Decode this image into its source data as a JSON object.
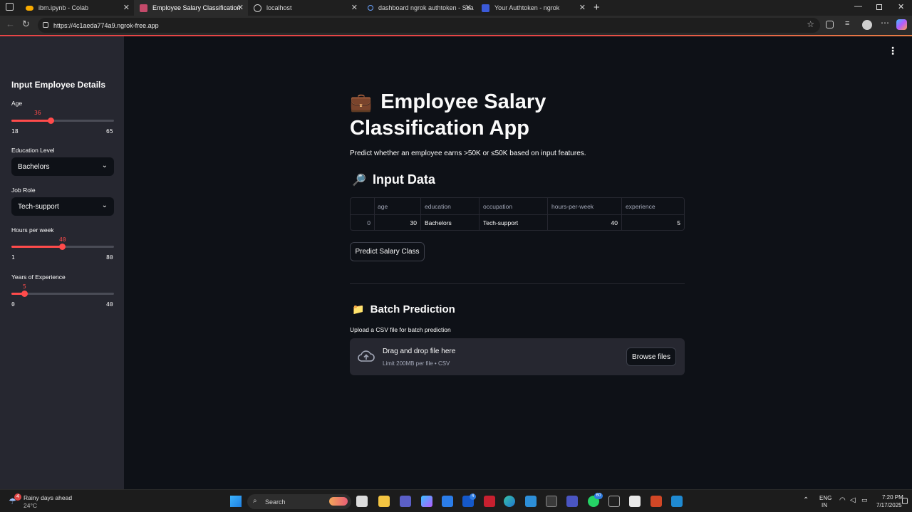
{
  "browser": {
    "tabs": [
      {
        "label": "ibm.ipynb - Colab",
        "active": false
      },
      {
        "label": "Employee Salary Classification",
        "active": true
      },
      {
        "label": "localhost",
        "active": false
      },
      {
        "label": "dashboard ngrok authtoken - Sea",
        "active": false
      },
      {
        "label": "Your Authtoken - ngrok",
        "active": false
      }
    ],
    "url": "https://4c1aeda774a9.ngrok-free.app"
  },
  "sidebar": {
    "title": "Input Employee Details",
    "age": {
      "label": "Age",
      "value": "36",
      "min": "18",
      "max": "65",
      "fraction": 0.383
    },
    "education": {
      "label": "Education Level",
      "selected": "Bachelors"
    },
    "job_role": {
      "label": "Job Role",
      "selected": "Tech-support"
    },
    "hours": {
      "label": "Hours per week",
      "value": "40",
      "min": "1",
      "max": "80",
      "fraction": 0.494
    },
    "experience": {
      "label": "Years of Experience",
      "value": "5",
      "min": "0",
      "max": "40",
      "fraction": 0.125
    }
  },
  "main": {
    "title_emoji": "💼",
    "title": "Employee Salary Classification App",
    "description": "Predict whether an employee earns >50K or ≤50K based on input features.",
    "input_section": {
      "emoji": "🔎",
      "title": "Input Data"
    },
    "table": {
      "columns": [
        "",
        "age",
        "education",
        "occupation",
        "hours-per-week",
        "experience"
      ],
      "rows": [
        [
          "0",
          "30",
          "Bachelors",
          "Tech-support",
          "40",
          "5"
        ]
      ]
    },
    "predict_button": "Predict Salary Class",
    "batch_section": {
      "emoji": "📁",
      "title": "Batch Prediction"
    },
    "upload_label": "Upload a CSV file for batch prediction",
    "drop_main": "Drag and drop file here",
    "drop_sub": "Limit 200MB per file • CSV",
    "browse_button": "Browse files"
  },
  "taskbar": {
    "weather_title": "Rainy days ahead",
    "weather_temp": "24°C",
    "weather_badge": "4",
    "search_placeholder": "Search",
    "lang_top": "ENG",
    "lang_bottom": "IN",
    "time": "7:20 PM",
    "date": "7/17/2025",
    "whatsapp_badge": "60",
    "l_badge": "4"
  },
  "colors": {
    "accent": "#ff4b4b",
    "sidebar": "#262730",
    "background": "#0e1117"
  }
}
